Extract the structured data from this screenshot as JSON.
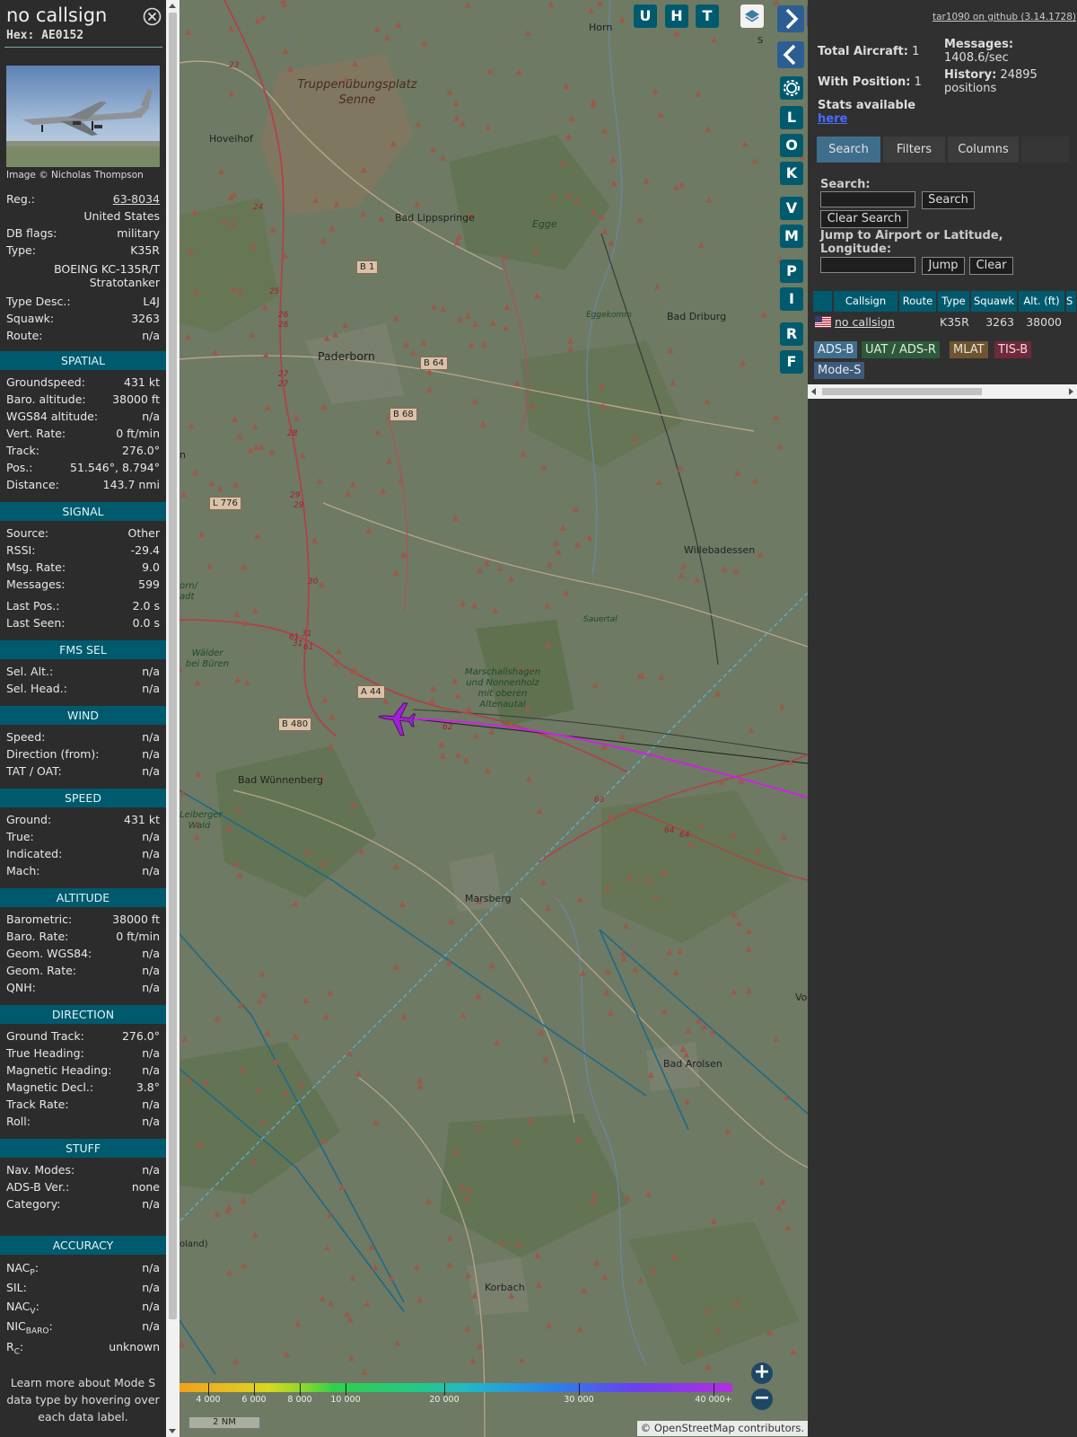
{
  "header": {
    "callsign": "no callsign",
    "hex_label": "Hex:",
    "hex": "AE0152"
  },
  "photo": {
    "credit": "Image © Nicholas Thompson"
  },
  "aircraft": {
    "reg_label": "Reg.:",
    "reg": "63-8034",
    "country": "United States",
    "dbflags_label": "DB flags:",
    "dbflags": "military",
    "type_label": "Type:",
    "type": "K35R",
    "type_full": "BOEING KC-135R/T Stratotanker",
    "type_desc_label": "Type Desc.:",
    "type_desc": "L4J",
    "squawk_label": "Squawk:",
    "squawk": "3263",
    "route_label": "Route:",
    "route": "n/a"
  },
  "spatial": {
    "title": "SPATIAL",
    "rows": [
      {
        "k": "Groundspeed:",
        "v": "431 kt"
      },
      {
        "k": "Baro. altitude:",
        "v": "38000 ft"
      },
      {
        "k": "WGS84 altitude:",
        "v": "n/a"
      },
      {
        "k": "Vert. Rate:",
        "v": "0 ft/min"
      },
      {
        "k": "Track:",
        "v": "276.0°"
      },
      {
        "k": "Pos.:",
        "v": "51.546°, 8.794°"
      },
      {
        "k": "Distance:",
        "v": "143.7 nmi"
      }
    ]
  },
  "signal": {
    "title": "SIGNAL",
    "rows": [
      {
        "k": "Source:",
        "v": "Other"
      },
      {
        "k": "RSSI:",
        "v": "-29.4"
      },
      {
        "k": "Msg. Rate:",
        "v": "9.0"
      },
      {
        "k": "Messages:",
        "v": "599"
      },
      {
        "k": "Last Pos.:",
        "v": "2.0 s"
      },
      {
        "k": "Last Seen:",
        "v": "0.0 s"
      }
    ]
  },
  "fms": {
    "title": "FMS SEL",
    "rows": [
      {
        "k": "Sel. Alt.:",
        "v": "n/a"
      },
      {
        "k": "Sel. Head.:",
        "v": "n/a"
      }
    ]
  },
  "wind": {
    "title": "WIND",
    "rows": [
      {
        "k": "Speed:",
        "v": "n/a"
      },
      {
        "k": "Direction (from):",
        "v": "n/a"
      },
      {
        "k": "TAT / OAT:",
        "v": "n/a"
      }
    ]
  },
  "speed": {
    "title": "SPEED",
    "rows": [
      {
        "k": "Ground:",
        "v": "431 kt"
      },
      {
        "k": "True:",
        "v": "n/a"
      },
      {
        "k": "Indicated:",
        "v": "n/a"
      },
      {
        "k": "Mach:",
        "v": "n/a"
      }
    ]
  },
  "altitude": {
    "title": "ALTITUDE",
    "rows": [
      {
        "k": "Barometric:",
        "v": "38000 ft"
      },
      {
        "k": "Baro. Rate:",
        "v": "0 ft/min"
      },
      {
        "k": "Geom. WGS84:",
        "v": "n/a"
      },
      {
        "k": "Geom. Rate:",
        "v": "n/a"
      },
      {
        "k": "QNH:",
        "v": "n/a"
      }
    ]
  },
  "direction": {
    "title": "DIRECTION",
    "rows": [
      {
        "k": "Ground Track:",
        "v": "276.0°"
      },
      {
        "k": "True Heading:",
        "v": "n/a"
      },
      {
        "k": "Magnetic Heading:",
        "v": "n/a"
      },
      {
        "k": "Magnetic Decl.:",
        "v": "3.8°"
      },
      {
        "k": "Track Rate:",
        "v": "n/a"
      },
      {
        "k": "Roll:",
        "v": "n/a"
      }
    ]
  },
  "stuff": {
    "title": "STUFF",
    "rows": [
      {
        "k": "Nav. Modes:",
        "v": "n/a"
      },
      {
        "k": "ADS-B Ver.:",
        "v": "none"
      },
      {
        "k": "Category:",
        "v": "n/a"
      }
    ]
  },
  "accuracy": {
    "title": "ACCURACY",
    "nacp": "NAC",
    "nacp_sub": "P",
    "nacp_v": "n/a",
    "sil": "SIL:",
    "sil_v": "n/a",
    "nacv": "NAC",
    "nacv_sub": "V",
    "nacv_v": "n/a",
    "nicbaro": "NIC",
    "nicbaro_sub": "BARO",
    "nicbaro_v": "n/a",
    "rc": "R",
    "rc_sub": "C",
    "rc_v": "unknown"
  },
  "footer_note": "Learn more about Mode S data type by hovering over each data label.",
  "map": {
    "labels": {
      "horn": "Horn",
      "hovelhof": "Hovelhof",
      "truppen": "Truppenübungsplatz",
      "senne": "Senne",
      "bad_lippspringe": "Bad Lippspringe",
      "egge": "Egge",
      "paderborn": "Paderborn",
      "eggekomm": "Eggekomm",
      "bad_driburg": "Bad Driburg",
      "willebadessen": "Willebadessen",
      "sauertal": "Sauertal",
      "walder": "Wälder\nbei Büren",
      "marschall": "Marschallshagen\nund Nonnenholz\nmit oberen\nAltenautal",
      "bad_wuennenberg": "Bad Wünnenberg",
      "leiberger": "Leiberger\nWald",
      "marsberg": "Marsberg",
      "bad_arolsen": "Bad Arolsen",
      "korbach": "Korbach",
      "born": "orn/\nadt",
      "oland": "oland)",
      "vo": "Vo",
      "n": "n",
      "st": "S"
    },
    "shields": {
      "b1": "B 1",
      "b64": "B 64",
      "b68": "B 68",
      "l776": "L 776",
      "a44": "A 44",
      "b480": "B 480"
    },
    "road_nums": [
      "23",
      "24",
      "25",
      "26",
      "26",
      "27",
      "27",
      "28",
      "29",
      "29",
      "30",
      "31",
      "31",
      "61",
      "61",
      "62",
      "63",
      "64",
      "64"
    ],
    "buttons": {
      "u": "U",
      "h": "H",
      "t": "T",
      "l": "L",
      "o": "O",
      "k": "K",
      "v": "V",
      "m": "M",
      "p": "P",
      "i": "I",
      "r": "R",
      "f": "F"
    },
    "zoom_in": "+",
    "zoom_out": "−",
    "altitude_ticks": [
      "4 000",
      "6 000",
      "8 000",
      "10 000",
      "20 000",
      "30 000",
      "40 000+"
    ],
    "scale": "2 NM",
    "attribution_prefix": "© ",
    "attribution_osm": "OpenStreetMap",
    "attribution_suffix": " contributors."
  },
  "right": {
    "github": "tar1090 on github (3.14.1728)",
    "total_label": "Total Aircraft:",
    "total": "1",
    "messages_label": "Messages:",
    "messages": "1408.6/sec",
    "withpos_label": "With Position:",
    "withpos": "1",
    "history_label": "History:",
    "history": "24895 positions",
    "stats_label": "Stats available",
    "stats_link": "here",
    "tabs": {
      "search": "Search",
      "filters": "Filters",
      "columns": "Columns"
    },
    "search_label": "Search:",
    "search_btn": "Search",
    "clear_search_btn": "Clear Search",
    "jump_label": "Jump to Airport or Latitude, Longitude:",
    "jump_btn": "Jump",
    "clear_btn": "Clear",
    "table": {
      "headers": [
        "Callsign",
        "Route",
        "Type",
        "Squawk",
        "Alt. (ft)",
        "S"
      ],
      "row": {
        "callsign": "no callsign",
        "route": "",
        "type": "K35R",
        "squawk": "3263",
        "alt": "38000"
      }
    },
    "sources": [
      {
        "label": "ADS-B",
        "bg": "#3f6e8c",
        "fg": "#e8eef4"
      },
      {
        "label": "UAT / ADS-R",
        "bg": "#2e5a3c",
        "fg": "#e0ece0"
      },
      {
        "label": "MLAT",
        "bg": "#6e5532",
        "fg": "#ece0d0"
      },
      {
        "label": "TIS-B",
        "bg": "#6e2a3a",
        "fg": "#f4d8de"
      },
      {
        "label": "Mode-S",
        "bg": "#3f5a78",
        "fg": "#e0e8f4"
      }
    ]
  },
  "colors": {
    "teal_header": "#005a6e",
    "panel_bg": "#2c2c2c",
    "track_line": "#d020e8",
    "aircraft": "#a020d8"
  }
}
